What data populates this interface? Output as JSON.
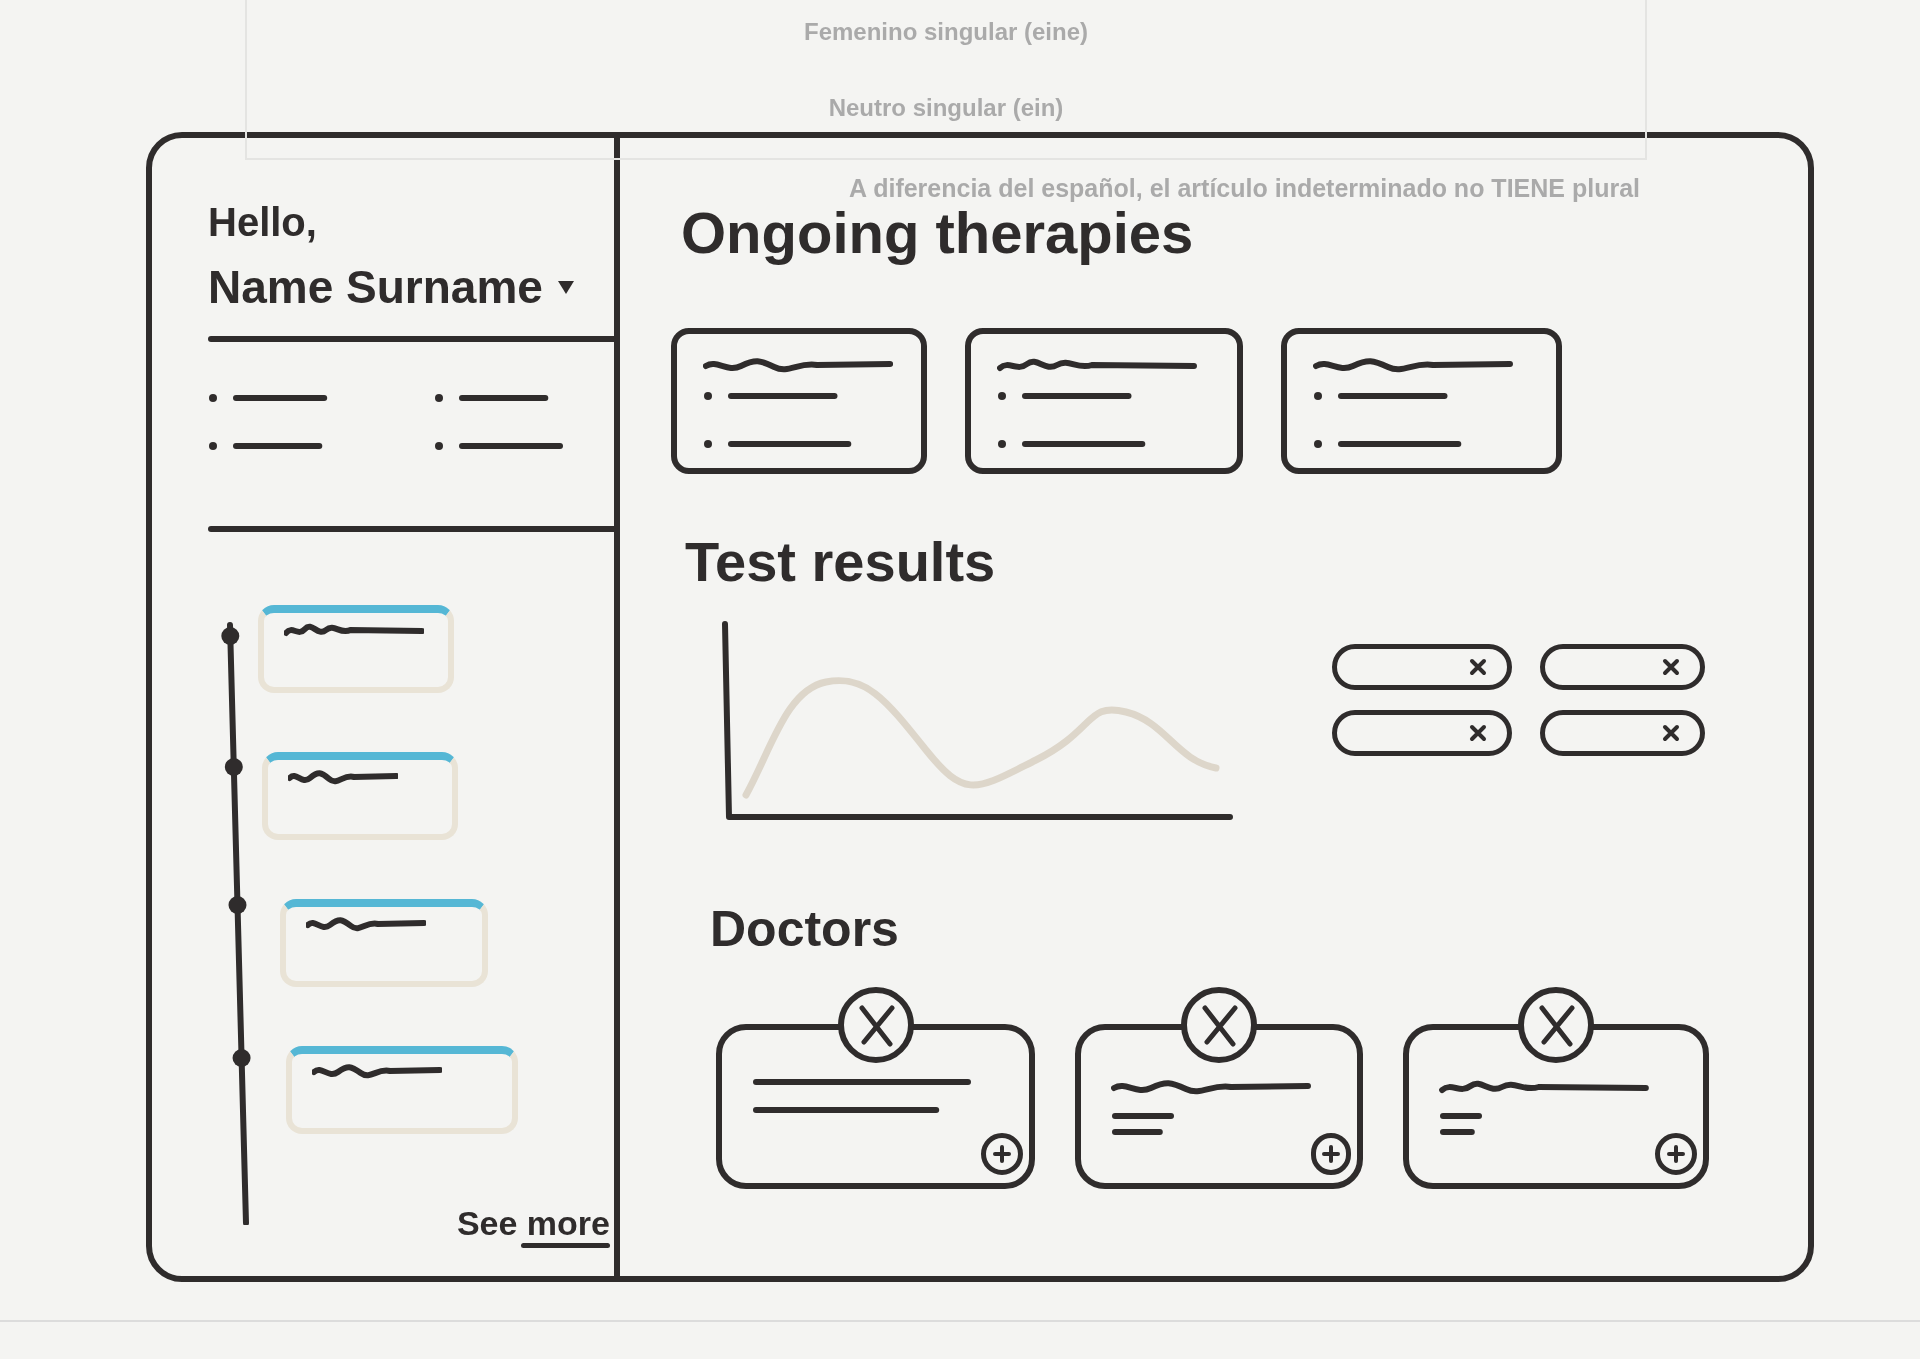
{
  "show_through": {
    "lines": [
      "Femenino singular (eine)",
      "Neutro singular (ein)"
    ],
    "note": "A diferencia del español, el artículo indeterminado no TIENE plural"
  },
  "sidebar": {
    "greeting": "Hello,",
    "user_name": "Name Surname",
    "see_more": "See more"
  },
  "therapies": {
    "title": "Ongoing therapies"
  },
  "test_results": {
    "title": "Test results"
  },
  "doctors": {
    "title": "Doctors"
  }
}
